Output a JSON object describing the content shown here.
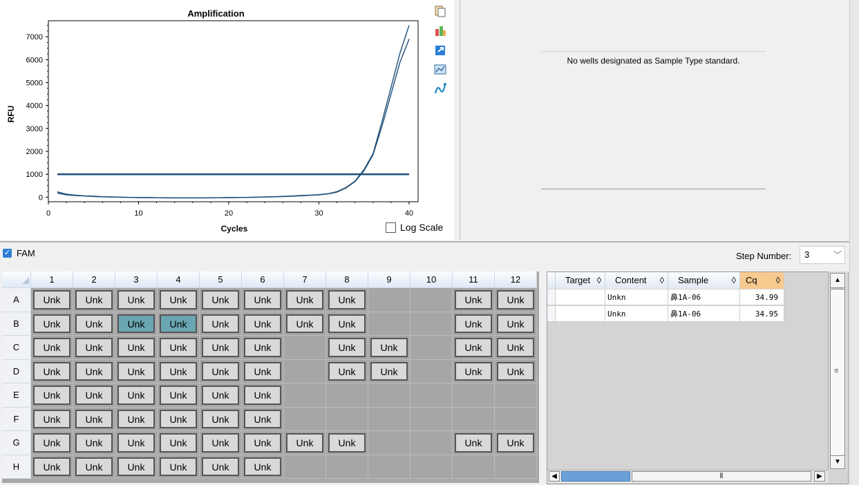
{
  "chart": {
    "title": "Amplification",
    "ylabel": "RFU",
    "xlabel": "Cycles",
    "log_scale_label": "Log Scale",
    "toolbar_icons": [
      "copy-icon",
      "export-icon",
      "open-icon",
      "chart-icon",
      "curve-icon"
    ]
  },
  "chart_data": {
    "type": "line",
    "title": "Amplification",
    "xlabel": "Cycles",
    "ylabel": "RFU",
    "xlim": [
      0,
      41
    ],
    "ylim": [
      -200,
      7700
    ],
    "x_ticks": [
      "0",
      "10",
      "20",
      "30",
      "40"
    ],
    "y_ticks": [
      "0",
      "1000",
      "2000",
      "3000",
      "4000",
      "5000",
      "6000",
      "7000"
    ],
    "grid": true,
    "threshold": 1000,
    "series": [
      {
        "x": [
          1,
          2,
          3,
          4,
          5,
          6,
          7,
          8,
          9,
          10,
          11,
          12,
          13,
          14,
          15,
          16,
          17,
          18,
          19,
          20,
          21,
          22,
          23,
          24,
          25,
          26,
          27,
          28,
          29,
          30,
          31,
          32,
          33,
          34,
          35,
          36,
          37,
          38,
          39,
          40
        ],
        "values": [
          230,
          130,
          90,
          60,
          40,
          20,
          10,
          0,
          -10,
          -15,
          -20,
          -25,
          -25,
          -30,
          -30,
          -30,
          -30,
          -25,
          -25,
          -20,
          -15,
          -10,
          0,
          10,
          20,
          35,
          50,
          70,
          90,
          110,
          150,
          240,
          420,
          700,
          1200,
          1900,
          3300,
          4800,
          6300,
          7500
        ]
      },
      {
        "x": [
          1,
          2,
          3,
          4,
          5,
          6,
          7,
          8,
          9,
          10,
          11,
          12,
          13,
          14,
          15,
          16,
          17,
          18,
          19,
          20,
          21,
          22,
          23,
          24,
          25,
          26,
          27,
          28,
          29,
          30,
          31,
          32,
          33,
          34,
          35,
          36,
          37,
          38,
          39,
          40
        ],
        "values": [
          180,
          100,
          70,
          50,
          30,
          15,
          5,
          -5,
          -10,
          -20,
          -20,
          -25,
          -30,
          -30,
          -30,
          -30,
          -30,
          -30,
          -25,
          -20,
          -15,
          -10,
          -5,
          5,
          15,
          25,
          40,
          60,
          80,
          100,
          140,
          220,
          400,
          680,
          1150,
          1850,
          3100,
          4500,
          5900,
          6900
        ]
      }
    ],
    "color": "#1f4e79"
  },
  "standard_panel": {
    "message": "No wells designated as Sample Type standard."
  },
  "fam": {
    "label": "FAM",
    "checked": true
  },
  "step": {
    "label": "Step Number:",
    "value": "3"
  },
  "plate": {
    "columns": [
      "1",
      "2",
      "3",
      "4",
      "5",
      "6",
      "7",
      "8",
      "9",
      "10",
      "11",
      "12"
    ],
    "rows": [
      {
        "label": "A",
        "wells": [
          "Unk",
          "Unk",
          "Unk",
          "Unk",
          "Unk",
          "Unk",
          "Unk",
          "Unk",
          "",
          "",
          "Unk",
          "Unk"
        ]
      },
      {
        "label": "B",
        "wells": [
          "Unk",
          "Unk",
          "Unk",
          "Unk",
          "Unk",
          "Unk",
          "Unk",
          "Unk",
          "",
          "",
          "Unk",
          "Unk"
        ]
      },
      {
        "label": "C",
        "wells": [
          "Unk",
          "Unk",
          "Unk",
          "Unk",
          "Unk",
          "Unk",
          "",
          "Unk",
          "Unk",
          "",
          "Unk",
          "Unk"
        ]
      },
      {
        "label": "D",
        "wells": [
          "Unk",
          "Unk",
          "Unk",
          "Unk",
          "Unk",
          "Unk",
          "",
          "Unk",
          "Unk",
          "",
          "Unk",
          "Unk"
        ]
      },
      {
        "label": "E",
        "wells": [
          "Unk",
          "Unk",
          "Unk",
          "Unk",
          "Unk",
          "Unk",
          "",
          "",
          "",
          "",
          "",
          ""
        ]
      },
      {
        "label": "F",
        "wells": [
          "Unk",
          "Unk",
          "Unk",
          "Unk",
          "Unk",
          "Unk",
          "",
          "",
          "",
          "",
          "",
          ""
        ]
      },
      {
        "label": "G",
        "wells": [
          "Unk",
          "Unk",
          "Unk",
          "Unk",
          "Unk",
          "Unk",
          "Unk",
          "Unk",
          "",
          "",
          "Unk",
          "Unk"
        ]
      },
      {
        "label": "H",
        "wells": [
          "Unk",
          "Unk",
          "Unk",
          "Unk",
          "Unk",
          "Unk",
          "",
          "",
          "",
          "",
          "",
          ""
        ]
      }
    ],
    "selected": [
      "B3",
      "B4"
    ]
  },
  "results": {
    "headers": [
      "Target",
      "Content",
      "Sample",
      "Cq"
    ],
    "sort_glyph": "◊",
    "rows": [
      {
        "target": "",
        "content": "Unkn",
        "sample": "鼻1A-06",
        "cq": "34.99"
      },
      {
        "target": "",
        "content": "Unkn",
        "sample": "鼻1A-06",
        "cq": "34.95"
      }
    ]
  }
}
